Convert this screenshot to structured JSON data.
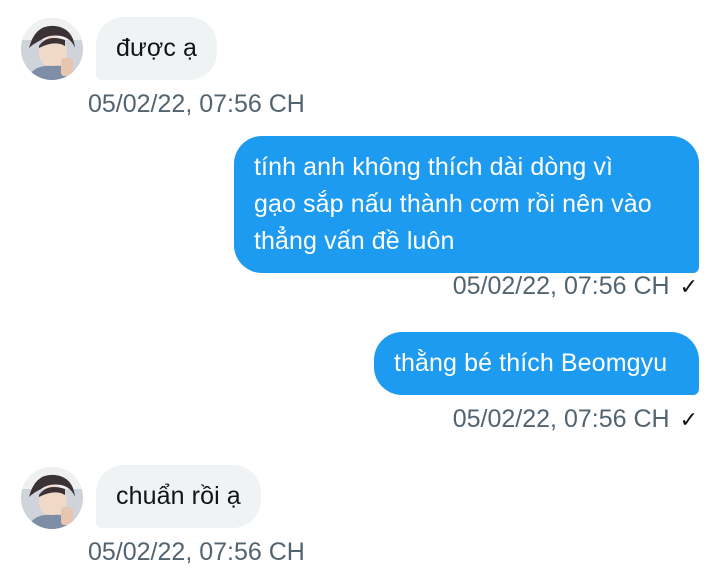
{
  "messages": [
    {
      "direction": "incoming",
      "text": "được ạ",
      "time": "05/02/22, 07:56 CH"
    },
    {
      "direction": "outgoing",
      "lines": [
        "tính anh không thích dài dòng vì",
        "gạo sắp nấu thành cơm rồi nên vào",
        "thẳng vấn đề luôn"
      ],
      "time": "05/02/22, 07:56 CH",
      "status_icon": "check-icon"
    },
    {
      "direction": "outgoing",
      "text": "thằng bé thích Beomgyu",
      "time": "05/02/22, 07:56 CH",
      "status_icon": "check-icon"
    },
    {
      "direction": "incoming",
      "text": "chuẩn rồi ạ",
      "time": "05/02/22, 07:56 CH"
    }
  ],
  "colors": {
    "outgoing_bubble": "#1d9bf0",
    "incoming_bubble": "#eff3f4",
    "timestamp": "#536471"
  },
  "check_glyph": "✓"
}
